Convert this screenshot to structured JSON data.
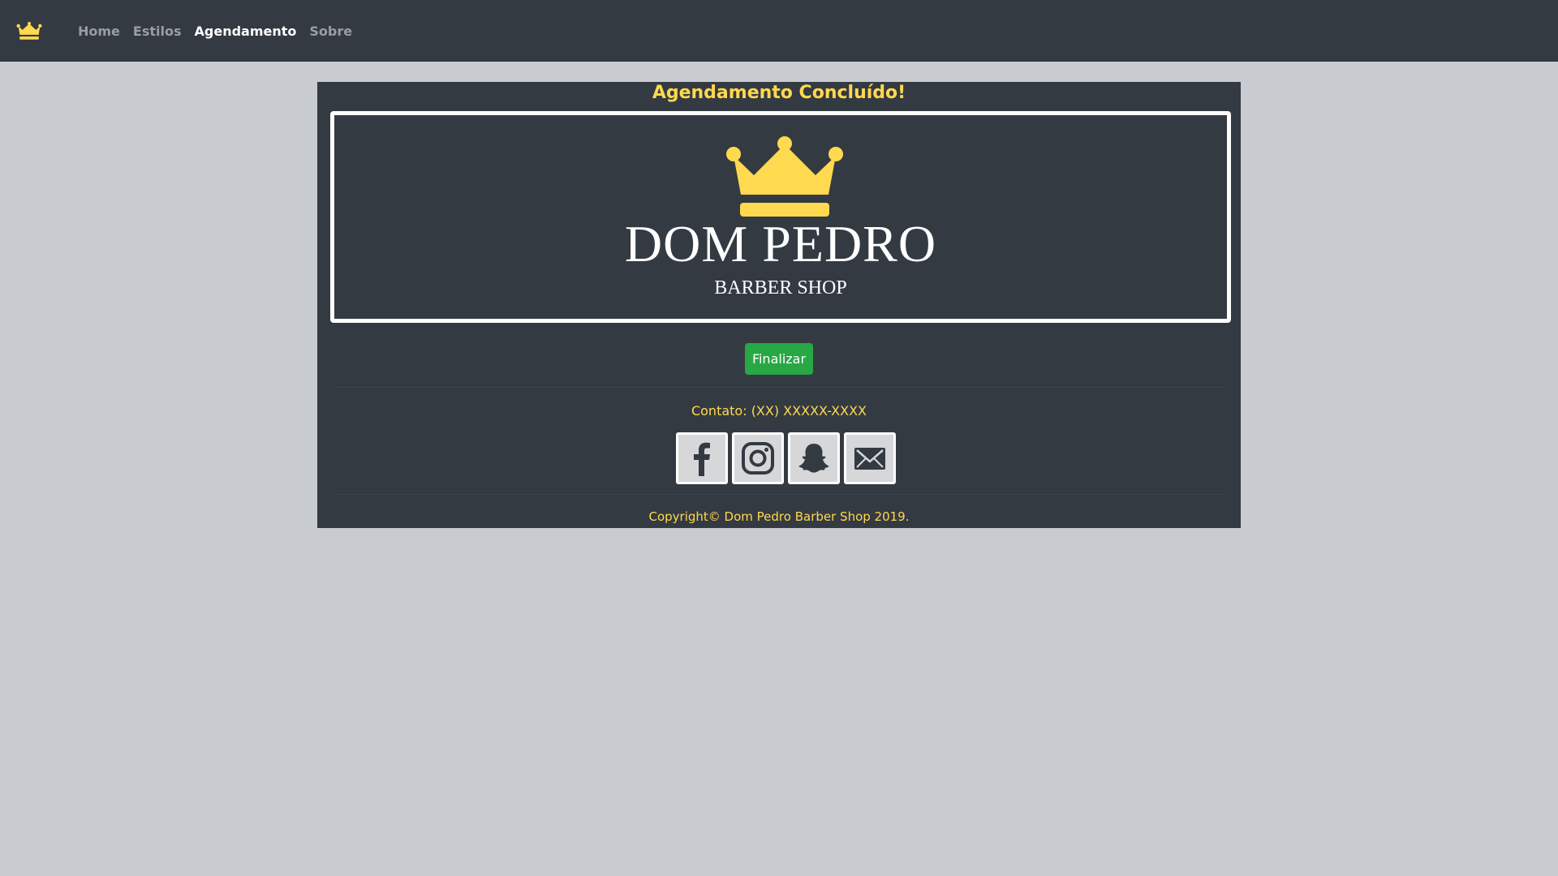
{
  "nav": {
    "logo_icon": "crown-icon",
    "items": [
      {
        "label": "Home",
        "active": false
      },
      {
        "label": "Estilos",
        "active": false
      },
      {
        "label": "Agendamento",
        "active": true
      },
      {
        "label": "Sobre",
        "active": false
      }
    ]
  },
  "main": {
    "title": "Agendamento Concluído!",
    "logo": {
      "icon": "crown-icon",
      "brand_name": "DOM PEDRO",
      "brand_subtitle": "BARBER SHOP"
    },
    "finalize_label": "Finalizar",
    "contact": "Contato: (XX) XXXXX-XXXX",
    "social": [
      {
        "name": "facebook",
        "icon": "facebook-icon"
      },
      {
        "name": "instagram",
        "icon": "instagram-icon"
      },
      {
        "name": "snapchat",
        "icon": "snapchat-icon"
      },
      {
        "name": "email",
        "icon": "mail-icon"
      }
    ],
    "copyright": "Copyright© Dom Pedro Barber Shop 2019."
  },
  "colors": {
    "navbar_bg": "#343a42",
    "page_bg": "#c8ccd0",
    "accent_yellow": "#ffd94f",
    "button_green": "#28a745"
  }
}
